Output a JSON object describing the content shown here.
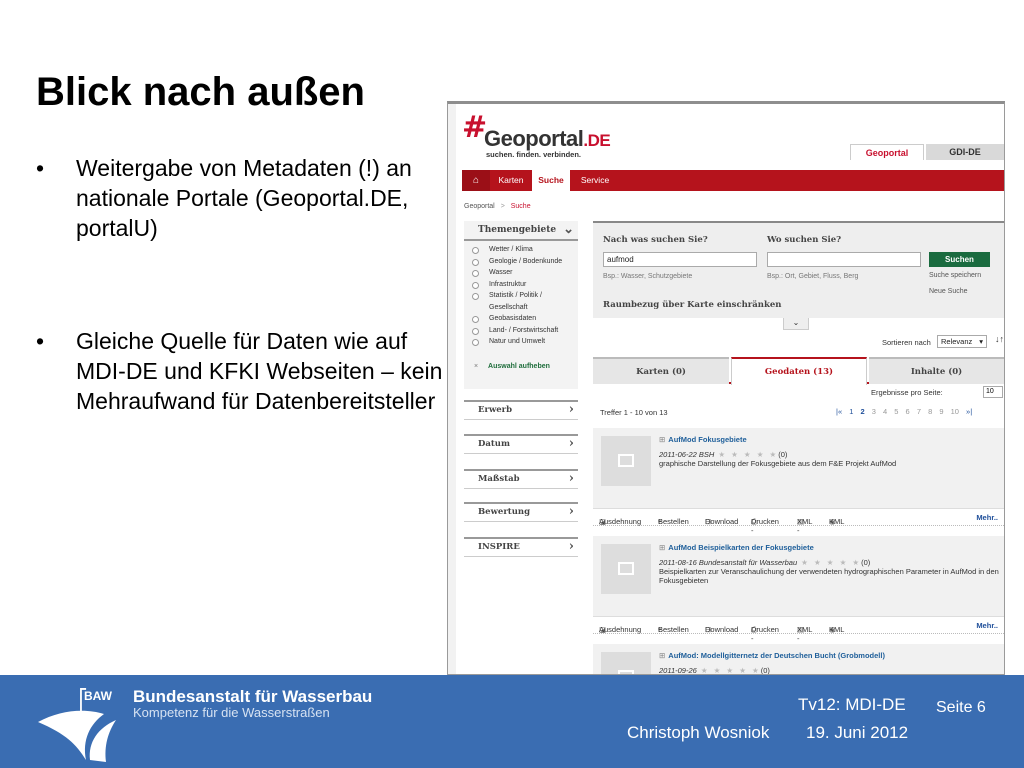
{
  "slide": {
    "title": "Blick nach außen",
    "bullets": [
      {
        "marker": "•",
        "text": "Weitergabe von Metadaten (!) an nationale Portale (Geoportal.DE, portalU)"
      },
      {
        "marker": "•",
        "text": "Gleiche Quelle für Daten wie auf MDI-DE und KFKI Webseiten – kein Mehraufwand für Datenbereitsteller"
      }
    ]
  },
  "portal": {
    "logo_hash": "#",
    "logo_name": "Geoportal",
    "logo_suffix": ".DE",
    "tagline": "suchen. finden. verbinden.",
    "top_tabs": [
      "Geoportal",
      "GDI-DE"
    ],
    "nav": {
      "home": "⌂",
      "items": [
        "Karten",
        "Suche",
        "Service"
      ]
    },
    "breadcrumb": {
      "root": "Geoportal",
      "sep": ">",
      "current": "Suche"
    },
    "facet": {
      "title": "Themengebiete",
      "items": [
        "Wetter / Klima",
        "Geologie / Bodenkunde",
        "Wasser",
        "Infrastruktur",
        "Statistik / Politik /",
        "Gesellschaft",
        "Geobasisdaten",
        "Land- / Forstwirtschaft",
        "Natur und Umwelt"
      ],
      "reset_x": "×",
      "reset_label": "Auswahl aufheben"
    },
    "side_sections": [
      "Erwerb",
      "Datum",
      "Maßstab",
      "Bewertung",
      "INSPIRE"
    ],
    "chevron": "›",
    "chevron_down": "⌄",
    "search": {
      "what_label": "Nach was suchen Sie?",
      "what_value": "aufmod",
      "what_hint": "Bsp.: Wasser, Schutzgebiete",
      "where_label": "Wo suchen Sie?",
      "where_value": "",
      "where_hint": "Bsp.: Ort, Gebiet, Fluss, Berg",
      "button": "Suchen",
      "save": "Suche speichern",
      "new": "Neue Suche",
      "raumbezug": "Raumbezug über Karte einschränken",
      "toggle": "⌄"
    },
    "sort": {
      "label": "Sortieren nach",
      "value": "Relevanz",
      "dir": "↓↑"
    },
    "result_tabs": [
      "Karten (0)",
      "Geodaten (13)",
      "Inhalte (0)"
    ],
    "per_page": {
      "label": "Ergebnisse pro Seite:",
      "value": "10"
    },
    "result_count": "Treffer 1 - 10 von 13",
    "pager": {
      "first": "|«",
      "pages": [
        "1",
        "2",
        "3",
        "4",
        "5",
        "6",
        "7",
        "8",
        "9",
        "10"
      ],
      "current": "2",
      "last": "»|"
    },
    "results": [
      {
        "title": "AufMod Fokusgebiete",
        "meta": "2011-06-22 BSH",
        "stars": "★ ★ ★ ★ ★",
        "count": "(0)",
        "desc": "graphische Darstellung der Fokusgebiete aus dem F&E Projekt AufMod"
      },
      {
        "title": "AufMod Beispielkarten der Fokusgebiete",
        "meta": "2011-08-16 Bundesanstalt für Wasserbau",
        "stars": "★ ★ ★ ★ ★",
        "count": "(0)",
        "desc": "Beispielkarten zur Veranschaulichung der verwendeten hydrographischen Parameter in AufMod in den Fokusgebieten"
      },
      {
        "title": "AufMod: Modellgitternetz der Deutschen Bucht (Grobmodell)",
        "meta": "2011-09-26",
        "stars": "★ ★ ★ ★ ★",
        "count": "(0)",
        "desc": ""
      }
    ],
    "actions": [
      "Ausdehnung",
      "Bestellen",
      "Download",
      "Drucken -",
      "XML -",
      "KML",
      "Mehr.."
    ],
    "plus": "⊞"
  },
  "footer": {
    "code": "BAW",
    "name": "Bundesanstalt für Wasserbau",
    "subtitle": "Kompetenz für die Wasserstraßen",
    "topic": "Tv12: MDI-DE",
    "page": "Seite 6",
    "author": "Christoph Wosniok",
    "date": "19. Juni 2012",
    "brand_color": "#3a6db2"
  }
}
